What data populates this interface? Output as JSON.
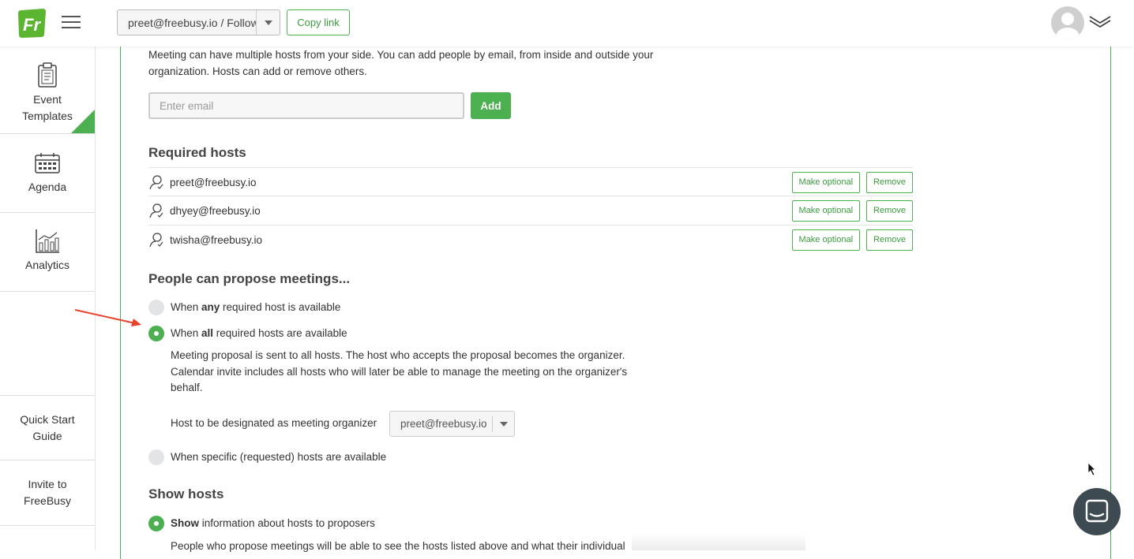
{
  "topbar": {
    "logo_text": "Fr",
    "account_selector": "preet@freebusy.io / Follow",
    "copy_link_label": "Copy link"
  },
  "sidebar": {
    "items": [
      {
        "label_line1": "Event",
        "label_line2": "Templates",
        "icon": "clipboard-icon",
        "active": true
      },
      {
        "label_line1": "Agenda",
        "label_line2": "",
        "icon": "calendar-icon",
        "active": false
      },
      {
        "label_line1": "Analytics",
        "label_line2": "",
        "icon": "bar-chart-icon",
        "active": false
      },
      {
        "label_line1": "Quick Start",
        "label_line2": "Guide",
        "icon": "",
        "active": false
      },
      {
        "label_line1": "Invite to",
        "label_line2": "FreeBusy",
        "icon": "",
        "active": false
      }
    ]
  },
  "hosts": {
    "description": "Meeting can have multiple hosts from your side. You can add people by email, from inside and outside your organization. Hosts can add or remove others.",
    "email_placeholder": "Enter email",
    "add_label": "Add",
    "required_title": "Required hosts",
    "list": [
      {
        "email": "preet@freebusy.io",
        "optional_label": "Make optional",
        "remove_label": "Remove"
      },
      {
        "email": "dhyey@freebusy.io",
        "optional_label": "Make optional",
        "remove_label": "Remove"
      },
      {
        "email": "twisha@freebusy.io",
        "optional_label": "Make optional",
        "remove_label": "Remove"
      }
    ]
  },
  "propose": {
    "title": "People can propose meetings...",
    "options": [
      {
        "pre": "When ",
        "bold": "any",
        "post": " required host is available",
        "selected": false
      },
      {
        "pre": "When ",
        "bold": "all",
        "post": " required hosts are available",
        "selected": true
      },
      {
        "pre": "",
        "bold": "",
        "post": "When specific (requested) hosts are available",
        "selected": false
      }
    ],
    "all_description": "Meeting proposal is sent to all hosts. The host who accepts the proposal becomes the organizer. Calendar invite includes all hosts who will later be able to manage the meeting on the organizer's behalf.",
    "organizer_label": "Host to be designated as meeting organizer",
    "organizer_value": "preet@freebusy.io"
  },
  "show_hosts": {
    "title": "Show hosts",
    "option_bold": "Show",
    "option_rest": " information about hosts to proposers",
    "description": "People who propose meetings will be able to see the hosts listed above and what their individual"
  },
  "colors": {
    "accent": "#4caf50",
    "arrow": "#e8412c",
    "chat": "#3d4a52"
  }
}
